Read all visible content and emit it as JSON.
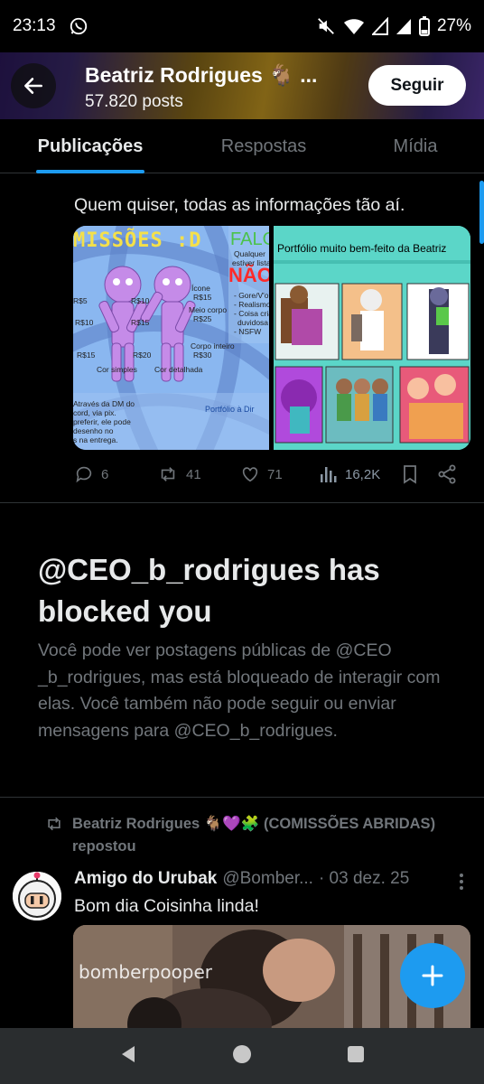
{
  "status_bar": {
    "time": "23:13",
    "battery": "27%",
    "icons": [
      "whatsapp-icon",
      "mute-icon",
      "wifi-icon",
      "signal-icon",
      "signal-icon",
      "battery-icon"
    ]
  },
  "header": {
    "name": "Beatriz Rodrigues 🐐 ...",
    "post_count": "57.820 posts",
    "follow_label": "Seguir"
  },
  "tabs": [
    {
      "label": "Publicações",
      "active": true
    },
    {
      "label": "Respostas",
      "active": false
    },
    {
      "label": "Mídia",
      "active": false
    }
  ],
  "post1": {
    "text": "Quem quiser, todas as informações tão aí.",
    "media": {
      "left": {
        "title": "MISSÕES :D",
        "title2": "FALO",
        "nao": "NÃO",
        "labels": [
          "Ícone",
          "R$15",
          "Meio corpo",
          "R$25",
          "Corpo inteiro",
          "R$30",
          "R$5",
          "R$10",
          "R$10",
          "R$15",
          "R$15",
          "R$20",
          "Cor simples",
          "Cor detalhada",
          "- Gore/V'ol",
          "- Realismo",
          "- Coisa cria",
          "duvidosa",
          "- NSFW",
          "Qualquer",
          "estiver lista",
          "Através da DM do",
          "cord, via pix.",
          "preferir, ele pode",
          "desenho no",
          "s na entrega.",
          "Portfólio à Dir"
        ]
      },
      "right": {
        "title": "Portfólio muito bem-feito da Beatriz"
      }
    },
    "stats": {
      "replies": "6",
      "reposts": "41",
      "likes": "71",
      "views": "16,2K"
    }
  },
  "blocked": {
    "title": "@CEO_b_rodrigues has blocked you",
    "description": "Você pode ver postagens públicas de @CEO _b_rodrigues, mas está bloqueado de interagir com elas. Você também não pode seguir ou enviar mensagens para @CEO_b_rodrigues."
  },
  "post2": {
    "repost_by": "Beatriz Rodrigues 🐐💜🧩 (COMISSÕES ABRIDAS)",
    "repost_suffix": "repostou",
    "author_name": "Amigo do Urubak",
    "author_handle": "@Bomber...",
    "date": "· 03 dez. 25",
    "text": "Bom dia Coisinha linda!",
    "video_watermark": "bomberpooper"
  },
  "colors": {
    "accent": "#1d9bf0",
    "background": "#000000",
    "text_primary": "#e7e9ea",
    "text_secondary": "#71767b",
    "divider": "#2f3336"
  }
}
